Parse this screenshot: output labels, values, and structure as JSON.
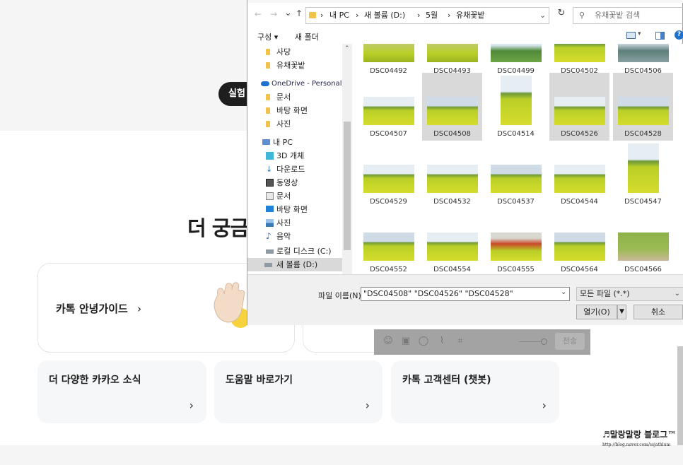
{
  "page": {
    "experiment_pill": "실험",
    "section_heading": "더 궁금",
    "guide_card_label": "카톡 안녕가이드",
    "chevron": "›",
    "small_cards": [
      {
        "title": "더 다양한 카카오 소식"
      },
      {
        "title": "도움말 바로가기"
      },
      {
        "title": "카톡 고객센터 (챗봇)"
      }
    ],
    "send_button": "전송",
    "watermark_title": "♬말랑말랑 블로그™",
    "watermark_url": "http://blog.naver.com/ssjathlum"
  },
  "dialog": {
    "breadcrumb": [
      "내 PC",
      "새 볼륨 (D:)",
      "5월",
      "유채꽃밭"
    ],
    "search_placeholder": "유채꽃밭 검색",
    "toolbar": {
      "organize": "구성",
      "new_folder": "새 폴더"
    },
    "nav": [
      {
        "label": "사당",
        "icon": "folder-icon"
      },
      {
        "label": "유채꽃밭",
        "icon": "folder-icon"
      },
      {
        "label": "OneDrive - Personal",
        "icon": "cloud-icon"
      },
      {
        "label": "문서",
        "icon": "folder-icon"
      },
      {
        "label": "바탕 화면",
        "icon": "folder-icon"
      },
      {
        "label": "사진",
        "icon": "folder-icon"
      },
      {
        "label": "내 PC",
        "icon": "pc-icon"
      },
      {
        "label": "3D 개체",
        "icon": "cube-icon"
      },
      {
        "label": "다운로드",
        "icon": "download-icon"
      },
      {
        "label": "동영상",
        "icon": "video-icon"
      },
      {
        "label": "문서",
        "icon": "document-icon"
      },
      {
        "label": "바탕 화면",
        "icon": "desktop-icon"
      },
      {
        "label": "사진",
        "icon": "pictures-icon"
      },
      {
        "label": "음악",
        "icon": "music-icon"
      },
      {
        "label": "로컬 디스크 (C:)",
        "icon": "drive-icon"
      },
      {
        "label": "새 볼륨 (D:)",
        "icon": "drive-icon",
        "selected": true
      }
    ],
    "files": [
      {
        "name": "DSC04492",
        "selected": false
      },
      {
        "name": "DSC04493",
        "selected": false
      },
      {
        "name": "DSC04499",
        "selected": false
      },
      {
        "name": "DSC04502",
        "selected": false
      },
      {
        "name": "DSC04506",
        "selected": false
      },
      {
        "name": "DSC04507",
        "selected": false
      },
      {
        "name": "DSC04508",
        "selected": true
      },
      {
        "name": "DSC04514",
        "selected": false
      },
      {
        "name": "DSC04526",
        "selected": true
      },
      {
        "name": "DSC04528",
        "selected": true
      },
      {
        "name": "DSC04529",
        "selected": false
      },
      {
        "name": "DSC04532",
        "selected": false
      },
      {
        "name": "DSC04537",
        "selected": false
      },
      {
        "name": "DSC04544",
        "selected": false
      },
      {
        "name": "DSC04547",
        "selected": false
      },
      {
        "name": "DSC04552",
        "selected": false
      },
      {
        "name": "DSC04554",
        "selected": false
      },
      {
        "name": "DSC04555",
        "selected": false
      },
      {
        "name": "DSC04564",
        "selected": false
      },
      {
        "name": "DSC04566",
        "selected": false
      }
    ],
    "filename_label": "파일 이름(N):",
    "filename_value": "\"DSC04508\" \"DSC04526\" \"DSC04528\"",
    "filter_value": "모든 파일 (*.*)",
    "open_button": "열기(O)",
    "cancel_button": "취소"
  },
  "colors": {
    "accent_blue": "#1e72cf",
    "folder_yellow": "#f3c24a",
    "selection_gray": "#d9d9d9",
    "field_green": "#b9cf27"
  }
}
